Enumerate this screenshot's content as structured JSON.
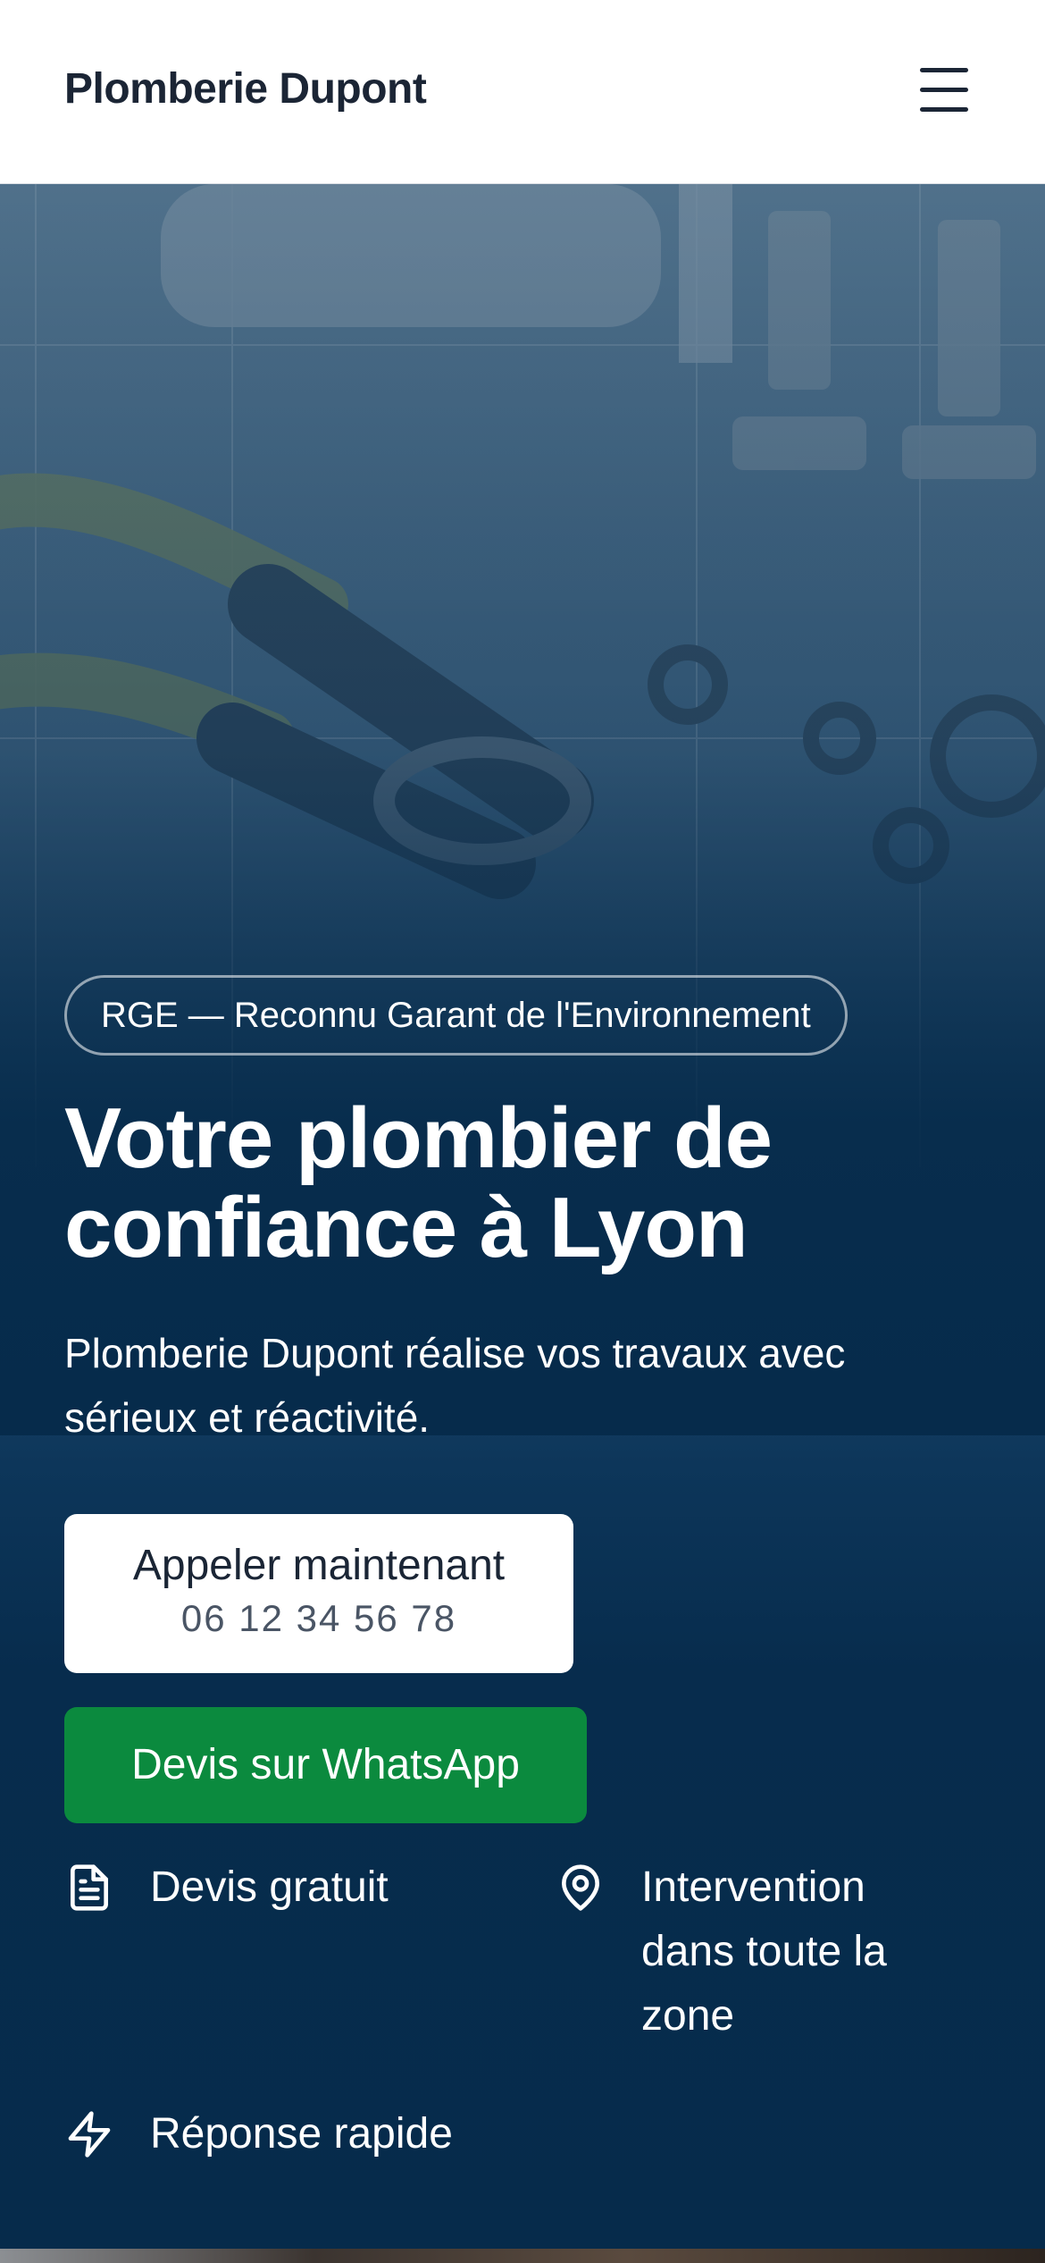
{
  "header": {
    "brand": "Plomberie Dupont",
    "menu_icon": "hamburger-menu-icon"
  },
  "hero": {
    "badge": "RGE — Reconnu Garant de l'Environnement",
    "title": "Votre plombier de confiance à Lyon",
    "subtitle": "Plomberie Dupont réalise vos travaux avec sérieux et réactivité.",
    "call_button": {
      "label": "Appeler maintenant",
      "phone": "06 12 34 56 78"
    },
    "whatsapp_button": {
      "label": "Devis sur WhatsApp"
    }
  },
  "features": [
    {
      "icon": "document-icon",
      "label": "Devis gratuit"
    },
    {
      "icon": "map-pin-icon",
      "label": "Intervention dans toute la zone"
    },
    {
      "icon": "lightning-icon",
      "label": "Réponse rapide"
    }
  ],
  "colors": {
    "navy": "#062b4b",
    "whatsapp_green": "#0b8a3e",
    "text_dark": "#1b2535"
  }
}
